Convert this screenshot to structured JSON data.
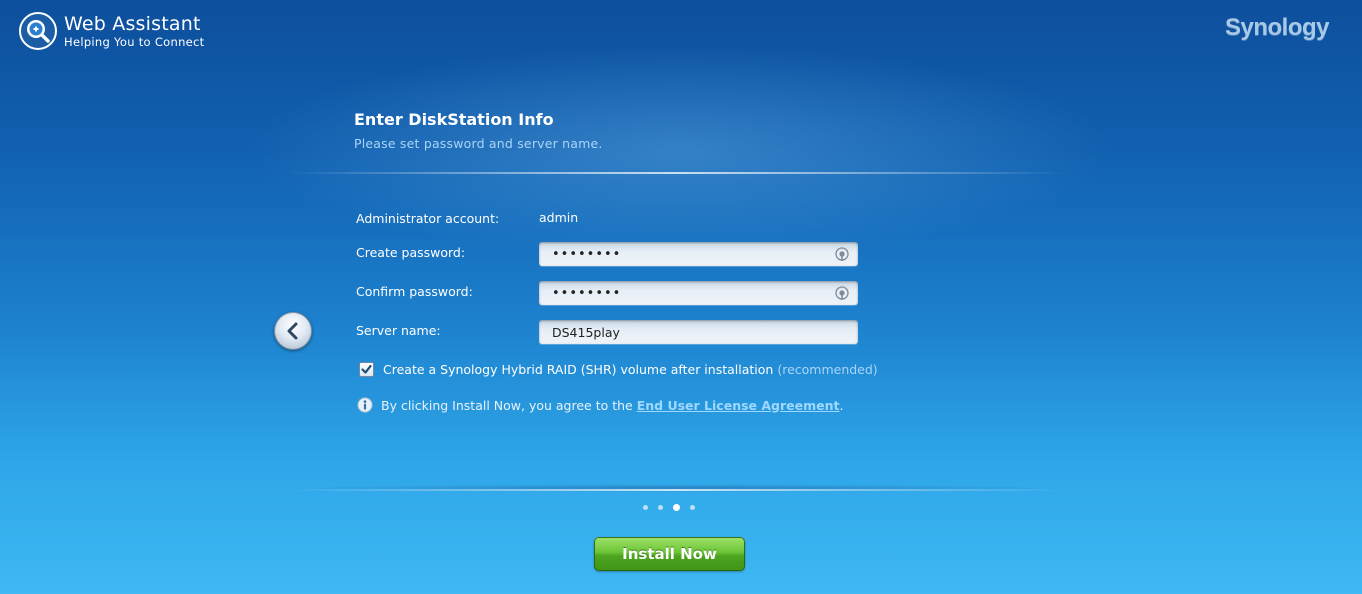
{
  "header": {
    "app_title": "Web Assistant",
    "app_subtitle": "Helping You to Connect",
    "brand": "Synology"
  },
  "page": {
    "title": "Enter DiskStation Info",
    "subtitle": "Please set password and server name."
  },
  "form": {
    "admin_label": "Administrator account:",
    "admin_value": "admin",
    "create_password_label": "Create password:",
    "create_password_value": "abcdefgh",
    "confirm_password_label": "Confirm password:",
    "confirm_password_value": "abcdefgh",
    "server_name_label": "Server name:",
    "server_name_value": "DS415play"
  },
  "shr_option": {
    "label": "Create a Synology Hybrid RAID (SHR) volume after installation",
    "recommended": "(recommended)",
    "checked": true
  },
  "agreement": {
    "prefix": "By clicking Install Now, you agree to the",
    "link_text": "End User License Agreement",
    "suffix": "."
  },
  "steps": {
    "total": 4,
    "current": 3
  },
  "actions": {
    "install_label": "Install Now"
  },
  "colors": {
    "accent_green": "#5cb82a",
    "link": "#9fd8ff"
  },
  "icons": {
    "logo": "web-assistant-magnifier-icon",
    "back": "chevron-left-icon",
    "eye": "reveal-password-icon",
    "info": "info-icon",
    "check": "checkmark-icon"
  }
}
